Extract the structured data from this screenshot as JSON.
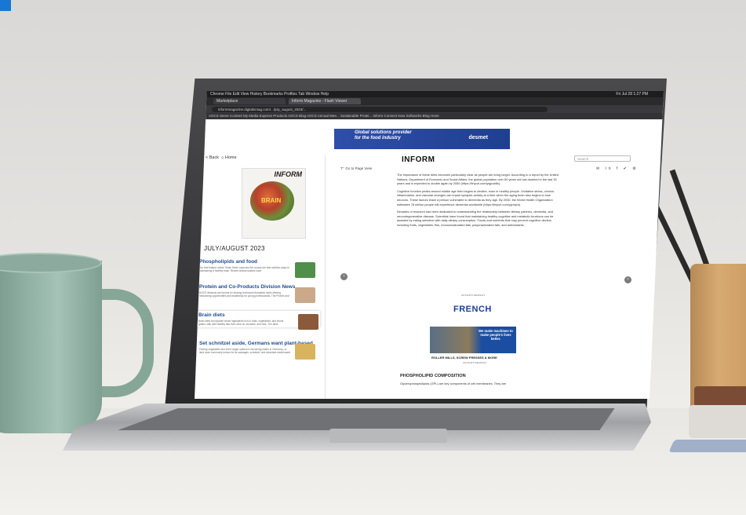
{
  "browser": {
    "menubar": "Chrome   File   Edit   View   History   Bookmarks   Profiles   Tab   Window   Help",
    "clock": "Fri Jul 28  1:27 PM",
    "tabs": [
      {
        "label": "Marketplace"
      },
      {
        "label": "Inform Magazine - Flash Viewer"
      }
    ],
    "url": "informmagazine.digitalsmag.com/.../july_august_2023/...",
    "bookmarks": "AOCS   Serve Content   My Media Express   Products   AOCS Blog   AOCS Annual Mee...   Sustainable Protei...   Inform   Connect Now   Softworks   Blog   Hone"
  },
  "ad_banner": {
    "text": "Global solutions provider for the food industry",
    "brand": "desmet"
  },
  "left_panel": {
    "back_label": "< Back",
    "home_label": "Home",
    "cover_brand": "INFORM",
    "cover_word": "BRAIN",
    "issue": "JULY/AUGUST 2023",
    "articles": [
      {
        "title": "Phospholipids and food",
        "blurb": "Our first feature article \"Brain Diets\" explores the crucial role that nutrition plays in maintaining a healthy brain. Recent clinical studies have"
      },
      {
        "title": "Protein and Co-Products Division News",
        "blurb": "AOCS divisions are forums for sharing technical information while offering networking opportunities and leadership for young professionals. The Protein and"
      },
      {
        "title": "Brain diets",
        "blurb": "Brain diets incorporate whole ingredients rich in fruits, vegetables, and whole grains, with mild healthy fats from olive oil, avocado, and nuts. The diets"
      },
      {
        "title": "Set schnitzel aside, Germans want plant-based",
        "blurb": "Finding vegetables and even vegan options is becoming easier in Germany—a land more commonly known for its sausages, schnitzel, and abundant meat-based"
      }
    ]
  },
  "reader": {
    "masthead": "INFORM",
    "go_to_page": "Go to Page View",
    "search_placeholder": "Search",
    "share_icons": "✉ in f ✔ ⚙",
    "paragraphs": [
      "The importance of these diets becomes particularly clear as people are living longer. According to a report by the United Nations, Department of Economic and Social Affairs, the global population over 60 years old has doubled in the last 30 years and is expected to double again by 2050 (https://tinyurl.com/ysjpub8s).",
      "Cognitive function peaks around middle age then begins to decline, even in healthy people. Oxidative stress, chronic inflammation, and vascular changes can impair synaptic activity at a time when the aging brain also begins to lose neurons. These factors leave a person vulnerable to dementia as they age. By 2030, the World Health Organization estimates 78 million people will experience dementia worldwide (https://tinyurl.com/yjzmjxn).",
      "Decades of research has been dedicated to understanding the relationship between dietary patterns, dementia, and neurodegenerative disease. Scientists have found that maintaining healthy cognitive and metabolic functions can be assisted by eating selective with daily dietary consumption. Foods and nutrients that may prevent cognitive decline, including fruits, vegetables, fish, monounsaturated fats, polyunsaturated fats, and antioxidants."
    ],
    "ad_label_top": "ADVERTISEMENT",
    "ad_brand": "FRENCH",
    "ad_tagline": "We make machines to make people's lives better.",
    "ad_caption": "ROLLER MILLS, SCREW PRESSES & MORE",
    "ad_label_bottom": "ADVERTISEMENT",
    "section_heading": "PHOSPHOLIPID COMPOSITION",
    "section_text": "Glycerophospholipids (GPL) are key components of cell membranes. They are"
  }
}
